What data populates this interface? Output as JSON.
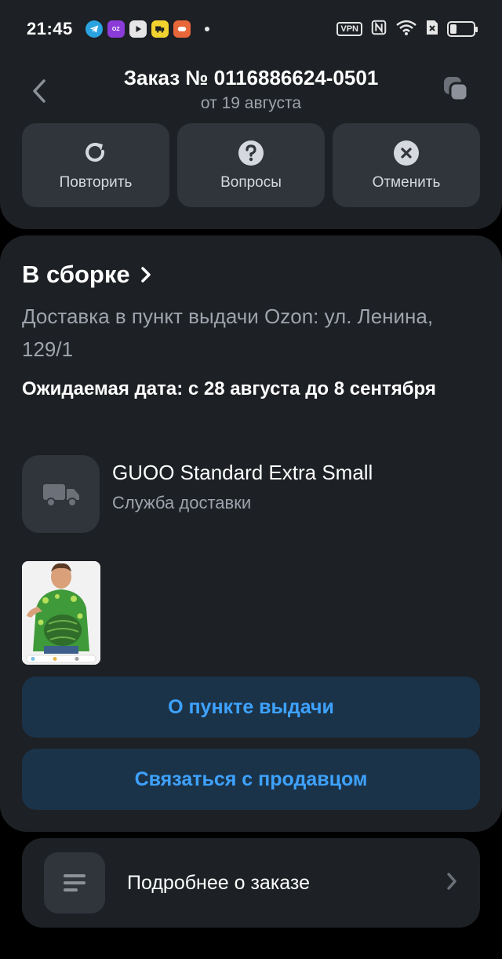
{
  "status_bar": {
    "time": "21:45",
    "apps": [
      {
        "name": "telegram-icon",
        "color": "#2aa3e0",
        "glyph": "➤"
      },
      {
        "name": "ozon-icon",
        "color": "#8a3bd8",
        "glyph": "OZON"
      },
      {
        "name": "youtube-icon",
        "color": "#e6e6e6",
        "glyph": "▶"
      },
      {
        "name": "delivery-app-icon",
        "color": "#f2d22e",
        "glyph": "🚚"
      },
      {
        "name": "game-app-icon",
        "color": "#e8673a",
        "glyph": "✦"
      }
    ],
    "vpn_label": "VPN",
    "battery_level": "28",
    "battery_fraction": 0.28
  },
  "header": {
    "title": "Заказ № 0116886624-0501",
    "subtitle": "от 19 августа",
    "actions": [
      {
        "label": "Повторить",
        "icon": "repeat-icon"
      },
      {
        "label": "Вопросы",
        "icon": "question-icon"
      },
      {
        "label": "Отменить",
        "icon": "cancel-icon"
      }
    ]
  },
  "order": {
    "status": "В сборке",
    "delivery_address": "Доставка в пункт выдачи Ozon: ул. Ленина, 129/1",
    "expected_date": "Ожидаемая дата: с 28 августа до 8 сентября",
    "service": {
      "name": "GUOO Standard Extra Small",
      "subtitle": "Служба доставки"
    },
    "buttons": {
      "pickup_point": "О пункте выдачи",
      "contact_seller": "Связаться с продавцом"
    }
  },
  "details": {
    "label": "Подробнее о заказе"
  },
  "colors": {
    "background": "#000000",
    "card": "#1d2024",
    "tile": "#30343b",
    "accent_button_bg": "#1b3349",
    "accent_text": "#3ea2ff",
    "secondary_text": "#9ea3ad"
  }
}
